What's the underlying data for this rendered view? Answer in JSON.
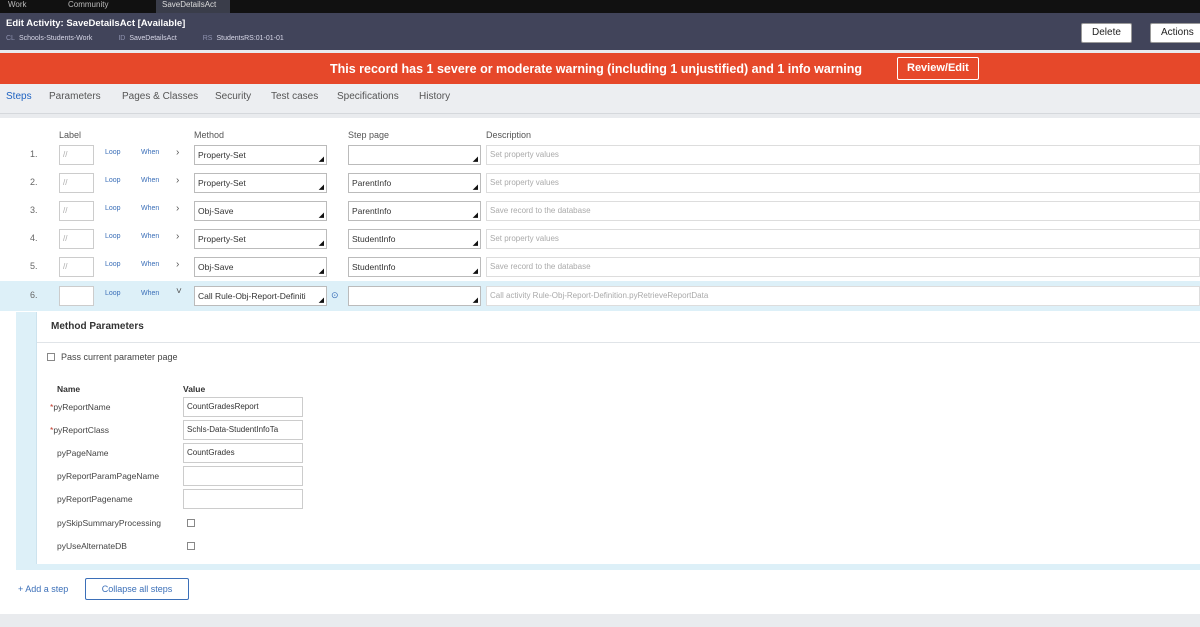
{
  "topbar": {
    "tabs": [
      {
        "label": "Work"
      },
      {
        "label": "Community"
      },
      {
        "label": "SaveDetailsAct"
      }
    ]
  },
  "header": {
    "title": "Edit Activity: SaveDetailsAct [Available]",
    "crumbs": [
      {
        "prefix": "CL",
        "text": "Schools-Students-Work"
      },
      {
        "prefix": "ID",
        "text": "SaveDetailsAct"
      },
      {
        "prefix": "RS",
        "text": "StudentsRS:01-01-01"
      }
    ],
    "delete_label": "Delete",
    "actions_label": "Actions"
  },
  "banner": {
    "message": "This record has 1 severe or moderate warning (including 1 unjustified) and 1 info warning",
    "review_label": "Review/Edit"
  },
  "tabs": [
    "Steps",
    "Parameters",
    "Pages & Classes",
    "Security",
    "Test cases",
    "Specifications",
    "History"
  ],
  "steps": {
    "columns": {
      "label": "Label",
      "method": "Method",
      "step_page": "Step page",
      "description": "Description"
    },
    "loop_label": "Loop",
    "when_label": "When",
    "rows": [
      {
        "num": "1.",
        "label": "//",
        "method": "Property-Set",
        "step_page": "",
        "description": "Set property values"
      },
      {
        "num": "2.",
        "label": "//",
        "method": "Property-Set",
        "step_page": "ParentInfo",
        "description": "Set property values"
      },
      {
        "num": "3.",
        "label": "//",
        "method": "Obj-Save",
        "step_page": "ParentInfo",
        "description": "Save record to the database"
      },
      {
        "num": "4.",
        "label": "//",
        "method": "Property-Set",
        "step_page": "StudentInfo",
        "description": "Set property values"
      },
      {
        "num": "5.",
        "label": "//",
        "method": "Obj-Save",
        "step_page": "StudentInfo",
        "description": "Save record to the database"
      },
      {
        "num": "6.",
        "label": "",
        "method": "Call Rule-Obj-Report-Definiti",
        "step_page": "",
        "description": "Call activity Rule-Obj-Report-Definition.pyRetrieveReportData"
      }
    ]
  },
  "method_params": {
    "title": "Method Parameters",
    "pass_label": "Pass current parameter page",
    "name_header": "Name",
    "value_header": "Value",
    "params": [
      {
        "name": "pyReportName",
        "value": "CountGradesReport",
        "required": true,
        "type": "text"
      },
      {
        "name": "pyReportClass",
        "value": "Schls-Data-StudentInfoTa",
        "required": true,
        "type": "text"
      },
      {
        "name": "pyPageName",
        "value": "CountGrades",
        "required": false,
        "type": "text"
      },
      {
        "name": "pyReportParamPageName",
        "value": "",
        "required": false,
        "type": "text"
      },
      {
        "name": "pyReportPagename",
        "value": "",
        "required": false,
        "type": "text"
      },
      {
        "name": "pySkipSummaryProcessing",
        "value": "",
        "required": false,
        "type": "checkbox"
      },
      {
        "name": "pyUseAlternateDB",
        "value": "",
        "required": false,
        "type": "checkbox"
      }
    ]
  },
  "footer": {
    "add_step_label": "+ Add a step",
    "collapse_label": "Collapse all steps"
  }
}
